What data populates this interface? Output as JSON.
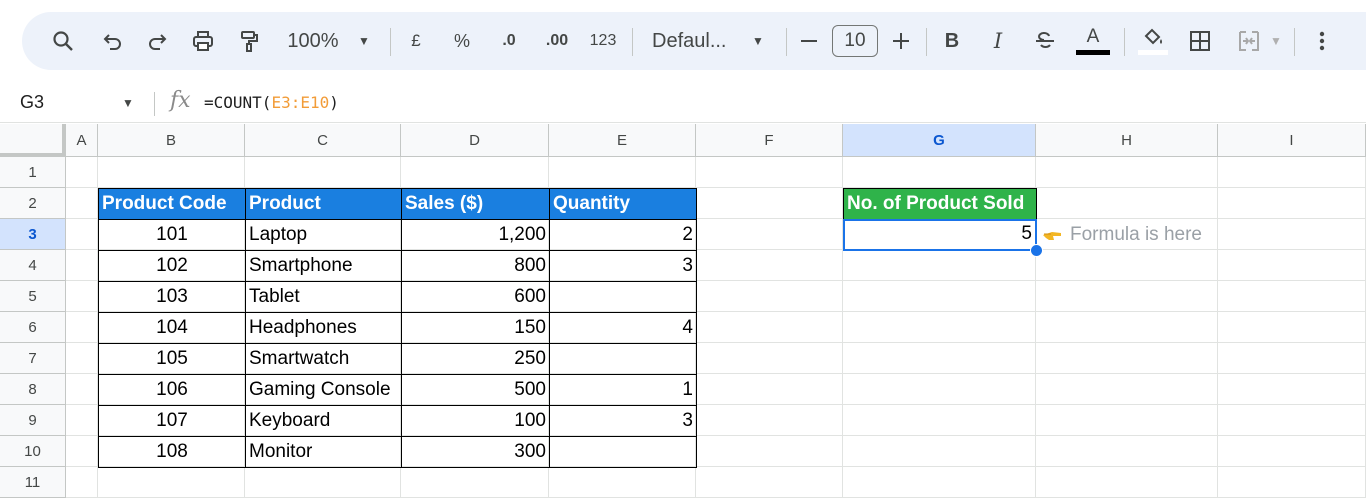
{
  "toolbar": {
    "zoom": "100%",
    "currency": "£",
    "percent": "%",
    "dec_less": ".0",
    "dec_more": ".00",
    "number_format": "123",
    "font": "Defaul...",
    "font_size": "10",
    "bold": "B",
    "italic": "I",
    "text_color_letter": "A"
  },
  "formula_bar": {
    "name_box": "G3",
    "formula_prefix": "=COUNT(",
    "formula_ref": "E3:E10",
    "formula_suffix": ")"
  },
  "columns": [
    "A",
    "B",
    "C",
    "D",
    "E",
    "F",
    "G",
    "H",
    "I"
  ],
  "rows": [
    "1",
    "2",
    "3",
    "4",
    "5",
    "6",
    "7",
    "8",
    "9",
    "10",
    "11"
  ],
  "table": {
    "headers": [
      "Product Code",
      "Product",
      "Sales ($)",
      "Quantity"
    ],
    "rows": [
      [
        "101",
        "Laptop",
        "1,200",
        "2"
      ],
      [
        "102",
        "Smartphone",
        "800",
        "3"
      ],
      [
        "103",
        "Tablet",
        "600",
        ""
      ],
      [
        "104",
        "Headphones",
        "150",
        "4"
      ],
      [
        "105",
        "Smartwatch",
        "250",
        ""
      ],
      [
        "106",
        "Gaming Console",
        "500",
        "1"
      ],
      [
        "107",
        "Keyboard",
        "100",
        "3"
      ],
      [
        "108",
        "Monitor",
        "300",
        ""
      ]
    ]
  },
  "result": {
    "header": "No. of Product Sold",
    "value": "5",
    "note": "Formula is here"
  },
  "colors": {
    "header_blue": "#1a7fe0",
    "header_green": "#2fb34a",
    "selection": "#1a73e8"
  }
}
